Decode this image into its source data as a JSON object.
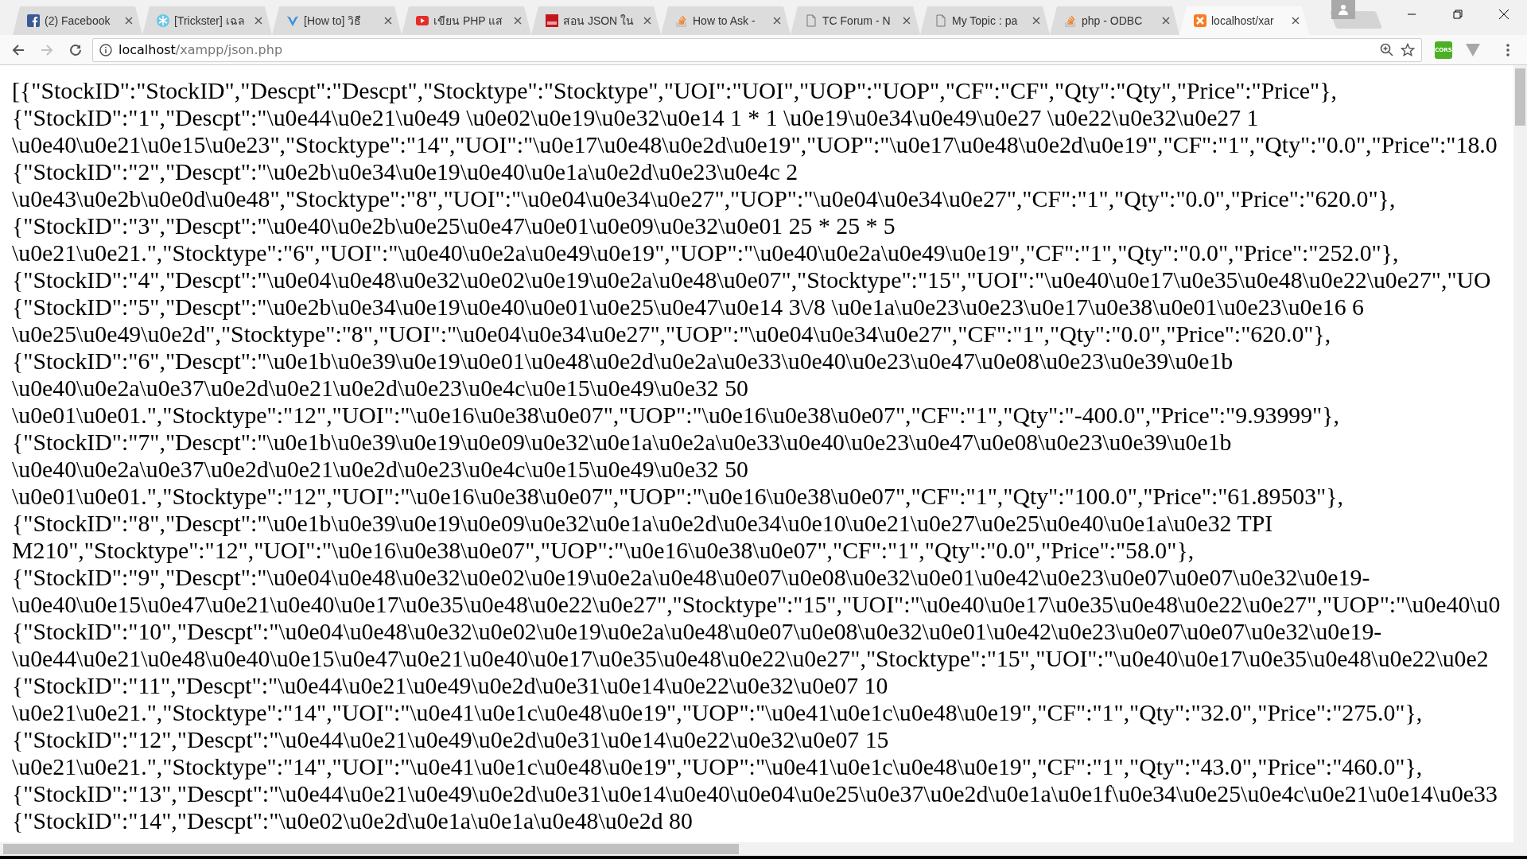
{
  "tabs": [
    {
      "title": "(2) Facebook",
      "kind": "facebook",
      "selected": false
    },
    {
      "title": "[Trickster] เฉล",
      "kind": "snowflake",
      "selected": false
    },
    {
      "title": "[How to] วิธี",
      "kind": "vee",
      "selected": false
    },
    {
      "title": "เขียน PHP แส",
      "kind": "play",
      "selected": false
    },
    {
      "title": "สอน JSON ใน",
      "kind": "tfd",
      "selected": false
    },
    {
      "title": "How to Ask -",
      "kind": "stack",
      "selected": false
    },
    {
      "title": "TC Forum - N",
      "kind": "page",
      "selected": false
    },
    {
      "title": "My Topic : pa",
      "kind": "page",
      "selected": false
    },
    {
      "title": "php - ODBC",
      "kind": "stack",
      "selected": false
    },
    {
      "title": "localhost/xar",
      "kind": "xampp",
      "selected": true
    }
  ],
  "toolbar": {
    "back_disabled": false,
    "forward_disabled": true,
    "address": {
      "host": "localhost",
      "path": "/xampp/json.php"
    },
    "extension_label": "CORS"
  },
  "body_lines": [
    "[{\"StockID\":\"StockID\",\"Descpt\":\"Descpt\",\"Stocktype\":\"Stocktype\",\"UOI\":\"UOI\",\"UOP\":\"UOP\",\"CF\":\"CF\",\"Qty\":\"Qty\",\"Price\":\"Price\"},",
    "{\"StockID\":\"1\",\"Descpt\":\"\\u0e44\\u0e21\\u0e49 \\u0e02\\u0e19\\u0e32\\u0e14 1 * 1 \\u0e19\\u0e34\\u0e49\\u0e27 \\u0e22\\u0e32\\u0e27 1",
    "\\u0e40\\u0e21\\u0e15\\u0e23\",\"Stocktype\":\"14\",\"UOI\":\"\\u0e17\\u0e48\\u0e2d\\u0e19\",\"UOP\":\"\\u0e17\\u0e48\\u0e2d\\u0e19\",\"CF\":\"1\",\"Qty\":\"0.0\",\"Price\":\"18.0",
    "{\"StockID\":\"2\",\"Descpt\":\"\\u0e2b\\u0e34\\u0e19\\u0e40\\u0e1a\\u0e2d\\u0e23\\u0e4c 2",
    "\\u0e43\\u0e2b\\u0e0d\\u0e48\",\"Stocktype\":\"8\",\"UOI\":\"\\u0e04\\u0e34\\u0e27\",\"UOP\":\"\\u0e04\\u0e34\\u0e27\",\"CF\":\"1\",\"Qty\":\"0.0\",\"Price\":\"620.0\"},",
    "{\"StockID\":\"3\",\"Descpt\":\"\\u0e40\\u0e2b\\u0e25\\u0e47\\u0e01\\u0e09\\u0e32\\u0e01 25 * 25 * 5",
    "\\u0e21\\u0e21.\",\"Stocktype\":\"6\",\"UOI\":\"\\u0e40\\u0e2a\\u0e49\\u0e19\",\"UOP\":\"\\u0e40\\u0e2a\\u0e49\\u0e19\",\"CF\":\"1\",\"Qty\":\"0.0\",\"Price\":\"252.0\"},",
    "{\"StockID\":\"4\",\"Descpt\":\"\\u0e04\\u0e48\\u0e32\\u0e02\\u0e19\\u0e2a\\u0e48\\u0e07\",\"Stocktype\":\"15\",\"UOI\":\"\\u0e40\\u0e17\\u0e35\\u0e48\\u0e22\\u0e27\",\"UO",
    "{\"StockID\":\"5\",\"Descpt\":\"\\u0e2b\\u0e34\\u0e19\\u0e40\\u0e01\\u0e25\\u0e47\\u0e14 3\\/8 \\u0e1a\\u0e23\\u0e23\\u0e17\\u0e38\\u0e01\\u0e23\\u0e16 6",
    "\\u0e25\\u0e49\\u0e2d\",\"Stocktype\":\"8\",\"UOI\":\"\\u0e04\\u0e34\\u0e27\",\"UOP\":\"\\u0e04\\u0e34\\u0e27\",\"CF\":\"1\",\"Qty\":\"0.0\",\"Price\":\"620.0\"},",
    "{\"StockID\":\"6\",\"Descpt\":\"\\u0e1b\\u0e39\\u0e19\\u0e01\\u0e48\\u0e2d\\u0e2a\\u0e33\\u0e40\\u0e23\\u0e47\\u0e08\\u0e23\\u0e39\\u0e1b",
    "\\u0e40\\u0e2a\\u0e37\\u0e2d\\u0e21\\u0e2d\\u0e23\\u0e4c\\u0e15\\u0e49\\u0e32 50",
    "\\u0e01\\u0e01.\",\"Stocktype\":\"12\",\"UOI\":\"\\u0e16\\u0e38\\u0e07\",\"UOP\":\"\\u0e16\\u0e38\\u0e07\",\"CF\":\"1\",\"Qty\":\"-400.0\",\"Price\":\"9.93999\"},",
    "{\"StockID\":\"7\",\"Descpt\":\"\\u0e1b\\u0e39\\u0e19\\u0e09\\u0e32\\u0e1a\\u0e2a\\u0e33\\u0e40\\u0e23\\u0e47\\u0e08\\u0e23\\u0e39\\u0e1b",
    "\\u0e40\\u0e2a\\u0e37\\u0e2d\\u0e21\\u0e2d\\u0e23\\u0e4c\\u0e15\\u0e49\\u0e32 50",
    "\\u0e01\\u0e01.\",\"Stocktype\":\"12\",\"UOI\":\"\\u0e16\\u0e38\\u0e07\",\"UOP\":\"\\u0e16\\u0e38\\u0e07\",\"CF\":\"1\",\"Qty\":\"100.0\",\"Price\":\"61.89503\"},",
    "{\"StockID\":\"8\",\"Descpt\":\"\\u0e1b\\u0e39\\u0e19\\u0e09\\u0e32\\u0e1a\\u0e2d\\u0e34\\u0e10\\u0e21\\u0e27\\u0e25\\u0e40\\u0e1a\\u0e32 TPI",
    "M210\",\"Stocktype\":\"12\",\"UOI\":\"\\u0e16\\u0e38\\u0e07\",\"UOP\":\"\\u0e16\\u0e38\\u0e07\",\"CF\":\"1\",\"Qty\":\"0.0\",\"Price\":\"58.0\"},",
    "{\"StockID\":\"9\",\"Descpt\":\"\\u0e04\\u0e48\\u0e32\\u0e02\\u0e19\\u0e2a\\u0e48\\u0e07\\u0e08\\u0e32\\u0e01\\u0e42\\u0e23\\u0e07\\u0e07\\u0e32\\u0e19-",
    "\\u0e40\\u0e15\\u0e47\\u0e21\\u0e40\\u0e17\\u0e35\\u0e48\\u0e22\\u0e27\",\"Stocktype\":\"15\",\"UOI\":\"\\u0e40\\u0e17\\u0e35\\u0e48\\u0e22\\u0e27\",\"UOP\":\"\\u0e40\\u0",
    "{\"StockID\":\"10\",\"Descpt\":\"\\u0e04\\u0e48\\u0e32\\u0e02\\u0e19\\u0e2a\\u0e48\\u0e07\\u0e08\\u0e32\\u0e01\\u0e42\\u0e23\\u0e07\\u0e07\\u0e32\\u0e19-",
    "\\u0e44\\u0e21\\u0e48\\u0e40\\u0e15\\u0e47\\u0e21\\u0e40\\u0e17\\u0e35\\u0e48\\u0e22\\u0e27\",\"Stocktype\":\"15\",\"UOI\":\"\\u0e40\\u0e17\\u0e35\\u0e48\\u0e22\\u0e2",
    "{\"StockID\":\"11\",\"Descpt\":\"\\u0e44\\u0e21\\u0e49\\u0e2d\\u0e31\\u0e14\\u0e22\\u0e32\\u0e07 10",
    "\\u0e21\\u0e21.\",\"Stocktype\":\"14\",\"UOI\":\"\\u0e41\\u0e1c\\u0e48\\u0e19\",\"UOP\":\"\\u0e41\\u0e1c\\u0e48\\u0e19\",\"CF\":\"1\",\"Qty\":\"32.0\",\"Price\":\"275.0\"},",
    "{\"StockID\":\"12\",\"Descpt\":\"\\u0e44\\u0e21\\u0e49\\u0e2d\\u0e31\\u0e14\\u0e22\\u0e32\\u0e07 15",
    "\\u0e21\\u0e21.\",\"Stocktype\":\"14\",\"UOI\":\"\\u0e41\\u0e1c\\u0e48\\u0e19\",\"UOP\":\"\\u0e41\\u0e1c\\u0e48\\u0e19\",\"CF\":\"1\",\"Qty\":\"43.0\",\"Price\":\"460.0\"},",
    "{\"StockID\":\"13\",\"Descpt\":\"\\u0e44\\u0e21\\u0e49\\u0e2d\\u0e31\\u0e14\\u0e40\\u0e04\\u0e25\\u0e37\\u0e2d\\u0e1a\\u0e1f\\u0e34\\u0e25\\u0e4c\\u0e21\\u0e14\\u0e33",
    "{\"StockID\":\"14\",\"Descpt\":\"\\u0e02\\u0e2d\\u0e1a\\u0e1a\\u0e48\\u0e2d 80"
  ]
}
